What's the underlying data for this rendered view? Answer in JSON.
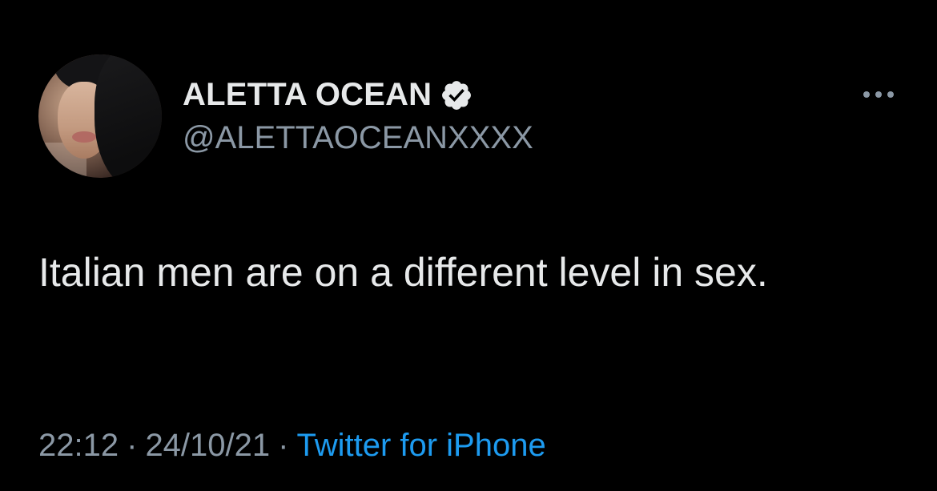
{
  "author": {
    "display_name": "ALETTA OCEAN",
    "username": "@ALETTAOCEANXXXX",
    "verified_icon": "verified-badge-icon",
    "avatar": "profile-photo"
  },
  "tweet": {
    "text": "Italian men are on a different level in sex."
  },
  "meta": {
    "time": "22:12",
    "separator": "·",
    "date": "24/10/21",
    "source": "Twitter for iPhone"
  },
  "colors": {
    "background": "#000000",
    "primary_text": "#e7e9ea",
    "secondary_text": "#8b98a5",
    "link": "#1d9bf0"
  },
  "icons": {
    "more": "more-options-icon"
  }
}
